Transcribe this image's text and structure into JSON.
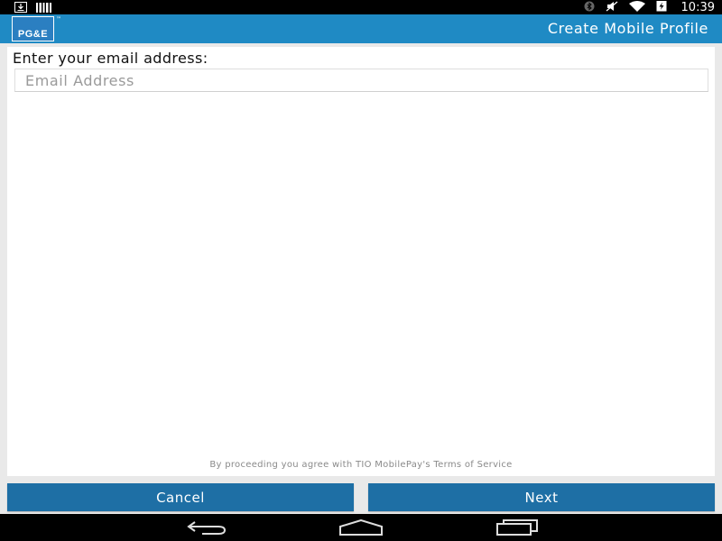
{
  "status_bar": {
    "time": "10:39",
    "left_icons": [
      "download-icon",
      "barcode-icon"
    ],
    "right_icons": [
      "bluetooth-icon",
      "mute-icon",
      "wifi-icon",
      "battery-charging-icon"
    ]
  },
  "app_bar": {
    "logo_text": "PG&E",
    "logo_tm": "™",
    "title": "Create Mobile Profile",
    "color": "#1f8ac4"
  },
  "form": {
    "prompt": "Enter your email address:",
    "email": {
      "value": "",
      "placeholder": "Email Address"
    },
    "terms": "By proceeding you agree with TIO MobilePay's Terms of Service"
  },
  "buttons": {
    "cancel": "Cancel",
    "next": "Next",
    "color": "#1e6fa5"
  },
  "nav_bar": {
    "icons": [
      "back-icon",
      "home-icon",
      "recents-icon"
    ]
  }
}
